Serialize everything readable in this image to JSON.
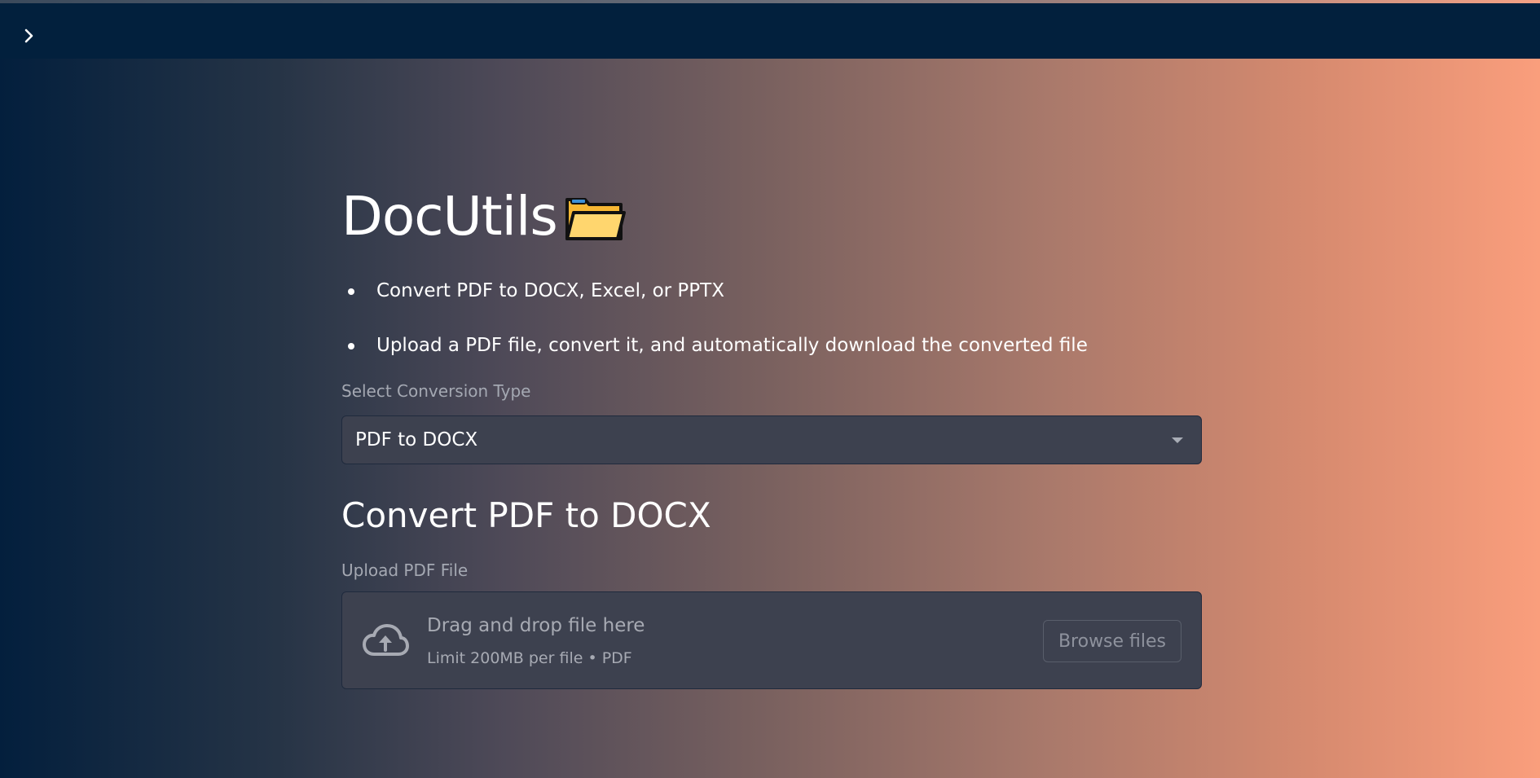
{
  "app": {
    "title": "DocUtils",
    "title_icon": "folder-icon"
  },
  "header": {
    "sidebar_toggle_icon": "chevron-right-icon",
    "background_color": "#02203d"
  },
  "intro": {
    "bullets": [
      "Convert PDF to DOCX, Excel, or PPTX",
      "Upload a PDF file, convert it, and automatically download the converted file"
    ]
  },
  "conversion": {
    "label": "Select Conversion Type",
    "selected": "PDF to DOCX"
  },
  "section": {
    "title": "Convert PDF to DOCX"
  },
  "uploader": {
    "label": "Upload PDF File",
    "drop_text": "Drag and drop file here",
    "limit_text": "Limit 200MB per file • PDF",
    "browse_label": "Browse files",
    "icon": "cloud-upload-icon"
  },
  "colors": {
    "gradient_start": "#031f3d",
    "gradient_end": "#fa9e7c",
    "input_background": "#3d414f"
  }
}
